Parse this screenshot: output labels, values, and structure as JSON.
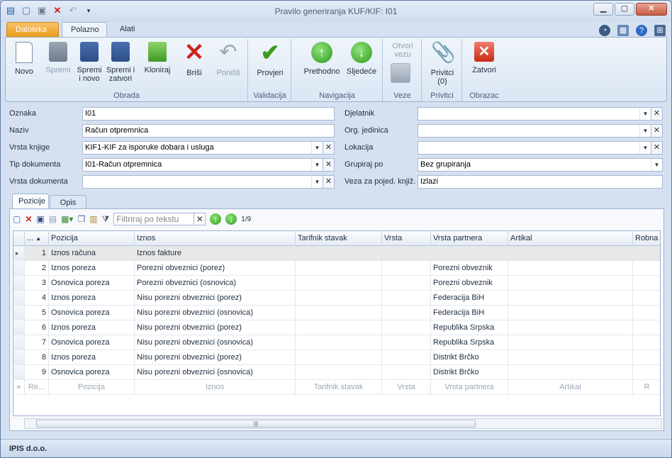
{
  "window": {
    "title": "Pravilo generiranja KUF/KIF: I01"
  },
  "tabs": {
    "file": "Datoteka",
    "home": "Polazno",
    "tools": "Alati"
  },
  "ribbon": {
    "groups": {
      "obrada": "Obrada",
      "validacija": "Validacija",
      "navigacija": "Navigacija",
      "veze": "Veze",
      "privitci": "Privitci",
      "obrazac": "Obrazac"
    },
    "novo": "Novo",
    "spremi": "Spremi",
    "spremi_novo": "Spremi i novo",
    "spremi_zatvori": "Spremi i zatvori",
    "kloniraj": "Kloniraj",
    "brisi": "Briši",
    "ponisti": "Poništi",
    "provjeri": "Provjeri",
    "prethodno": "Prethodno",
    "sljedece": "Sljedeće",
    "otvori_vezu": "Otvori vezu",
    "privitci": "Privitci (0)",
    "zatvori": "Zatvori"
  },
  "form": {
    "oznaka_label": "Oznaka",
    "oznaka": "I01",
    "naziv_label": "Naziv",
    "naziv": "Račun otpremnica",
    "vrsta_knjige_label": "Vrsta knjige",
    "vrsta_knjige": "KIF1-KIF za isporuke dobara i usluga",
    "tip_dokumenta_label": "Tip dokumenta",
    "tip_dokumenta": "I01-Račun otpremnica",
    "vrsta_dokumenta_label": "Vrsta dokumenta",
    "vrsta_dokumenta": "",
    "djelatnik_label": "Djelatnik",
    "djelatnik": "",
    "org_jedinica_label": "Org. jedinica",
    "org_jedinica": "",
    "lokacija_label": "Lokacija",
    "lokacija": "",
    "grupiraj_po_label": "Grupiraj po",
    "grupiraj_po": "Bez grupiranja",
    "veza_label": "Veza za pojed. knjiž.",
    "veza": "Izlazi"
  },
  "subtabs": {
    "pozicije": "Pozicije",
    "opis": "Opis"
  },
  "grid_toolbar": {
    "filter_placeholder": "Filtriraj po tekstu",
    "page": "1/9"
  },
  "grid": {
    "columns": [
      "...",
      "Pozicija",
      "Iznos",
      "Tarifnik stavak",
      "Vrsta",
      "Vrsta partnera",
      "Artikal",
      "Robna g"
    ],
    "rows": [
      {
        "rb": "1",
        "pozicija": "Iznos računa",
        "iznos": "Iznos fakture",
        "partner": ""
      },
      {
        "rb": "2",
        "pozicija": "Iznos poreza",
        "iznos": "Porezni obveznici (porez)",
        "partner": "Porezni obveznik"
      },
      {
        "rb": "3",
        "pozicija": "Osnovica poreza",
        "iznos": "Porezni obveznici (osnovica)",
        "partner": "Porezni obveznik"
      },
      {
        "rb": "4",
        "pozicija": "Iznos poreza",
        "iznos": "Nisu porezni obveznici (porez)",
        "partner": "Federacija BiH"
      },
      {
        "rb": "5",
        "pozicija": "Osnovica poreza",
        "iznos": "Nisu porezni obveznici (osnovica)",
        "partner": "Federacija BiH"
      },
      {
        "rb": "6",
        "pozicija": "Iznos poreza",
        "iznos": "Nisu porezni obveznici (porez)",
        "partner": "Republika Srpska"
      },
      {
        "rb": "7",
        "pozicija": "Osnovica poreza",
        "iznos": "Nisu porezni obveznici (osnovica)",
        "partner": "Republika Srpska"
      },
      {
        "rb": "8",
        "pozicija": "Iznos poreza",
        "iznos": "Nisu porezni obveznici (porez)",
        "partner": "Distrikt Brčko"
      },
      {
        "rb": "9",
        "pozicija": "Osnovica poreza",
        "iznos": "Nisu porezni obveznici (osnovica)",
        "partner": "Distrikt Brčko"
      }
    ],
    "new_row": [
      "Re...",
      "Pozicija",
      "Iznos",
      "Tarifnik stavak",
      "Vrsta",
      "Vrsta partnera",
      "Artikal",
      "R"
    ]
  },
  "status": {
    "company": "IPIS d.o.o."
  }
}
